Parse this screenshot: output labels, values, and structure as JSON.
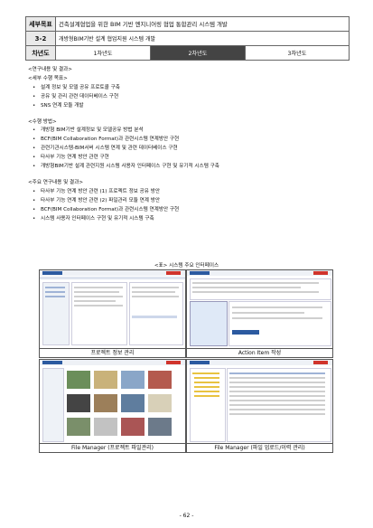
{
  "header": {
    "task_label": "세부목표",
    "task_text": "건축설계협업을 위한 BIM 기반 엔지니어링 협업 통합관리 시스템 개발",
    "sub_label": "3-2",
    "sub_text": "개방형BIM기반 설계 협업지원 시스템 개발",
    "year_label": "차년도",
    "years": [
      "1차년도",
      "2차년도",
      "3차년도"
    ],
    "active_year_index": 1
  },
  "content": {
    "heading": "<연구내용 및 결과>",
    "sections": [
      {
        "title": "<세부 수행 목표>",
        "items": [
          "설계 정보 및 모델 공유 프로토콜 구축",
          "공유 및 관리 관련 데이터베이스 구현",
          "SNS 연계 모듈 개발"
        ]
      },
      {
        "title": "<수행 방법>",
        "items": [
          "개방형 BIM기반 설계정보 및 모델공유 방법 분석",
          "BCF(BIM Collaboration Format)과 관련시스템 연계방안 구현",
          "관련기관시스템-BIM서버 시스템 연계 및 관련 데이터베이스 구현",
          "타사부 기능 연계 방안 관련 구현",
          "개방형BIM기반 설계 관련지원 시스템 사용자 인터페이스 구현 및 유기적 시스템 구축"
        ]
      },
      {
        "title": "<주요 연구내용 및 결과>",
        "items": [
          "타사부 기능 연계 방안 관련 (1) 프로젝트 정보 공유 방안",
          "타사부 기능 연계 방안 관련 (2) 파일관리 모듈 연계 방안",
          "BCF(BIM Collaboration Format)과 관련시스템 연계방안 구현",
          "시스템 사용자 인터페이스 구현 및 유기적 시스템 구축"
        ]
      }
    ]
  },
  "figure": {
    "title": "<표> 시스템 주요 인터페이스",
    "captions": [
      "프로젝트 정보 관리",
      "Action Item 작성",
      "File Manager (프로젝트 파일관리)",
      "File Manager (파일 업로드/이력 관리)"
    ],
    "colors": {
      "brand_red": "#d0342c",
      "header_blue": "#2c5aa0",
      "folder_yellow": "#e8c341"
    }
  },
  "footer": {
    "page_number": "- 62 -"
  }
}
